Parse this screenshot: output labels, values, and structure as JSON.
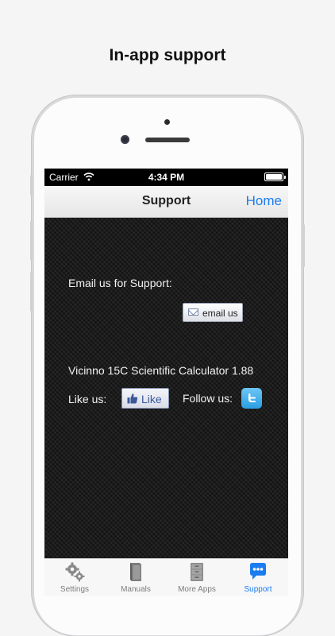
{
  "caption": "In-app support",
  "status_bar": {
    "carrier": "Carrier",
    "time": "4:34 PM"
  },
  "nav": {
    "title": "Support",
    "home": "Home"
  },
  "content": {
    "email_label": "Email us for Support:",
    "email_button": "email us",
    "version": "Vicinno 15C Scientific Calculator 1.88",
    "like_label": "Like us:",
    "like_button": "Like",
    "follow_label": "Follow us:"
  },
  "tabs": [
    {
      "label": "Settings",
      "icon": "gears-icon",
      "active": false
    },
    {
      "label": "Manuals",
      "icon": "book-icon",
      "active": false
    },
    {
      "label": "More Apps",
      "icon": "cabinet-icon",
      "active": false
    },
    {
      "label": "Support",
      "icon": "chat-bubble-icon",
      "active": true
    }
  ],
  "colors": {
    "accent": "#1a7cf0",
    "twitter": "#2a9ee2",
    "facebook": "#3b5998"
  }
}
